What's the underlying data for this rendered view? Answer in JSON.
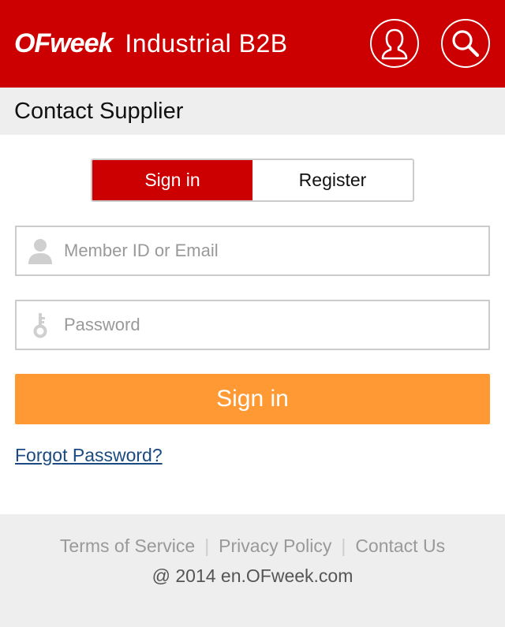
{
  "header": {
    "logo_mark": "OFweek",
    "site_name": "Industrial B2B",
    "user_icon": "user-icon",
    "search_icon": "search-icon",
    "background_color": "#cc0000"
  },
  "page": {
    "title": "Contact Supplier"
  },
  "tabs": [
    {
      "label": "Sign in",
      "active": true
    },
    {
      "label": "Register",
      "active": false
    }
  ],
  "form": {
    "member_field": {
      "placeholder": "Member ID or Email",
      "value": "",
      "icon": "person-icon"
    },
    "password_field": {
      "placeholder": "Password",
      "value": "",
      "icon": "key-icon"
    },
    "submit_label": "Sign in",
    "submit_color": "#ff9933",
    "forgot_label": "Forgot Password?"
  },
  "footer": {
    "links": [
      "Terms of Service",
      "Privacy Policy",
      "Contact Us"
    ],
    "separator": "|",
    "copyright": "@ 2014 en.OFweek.com"
  }
}
